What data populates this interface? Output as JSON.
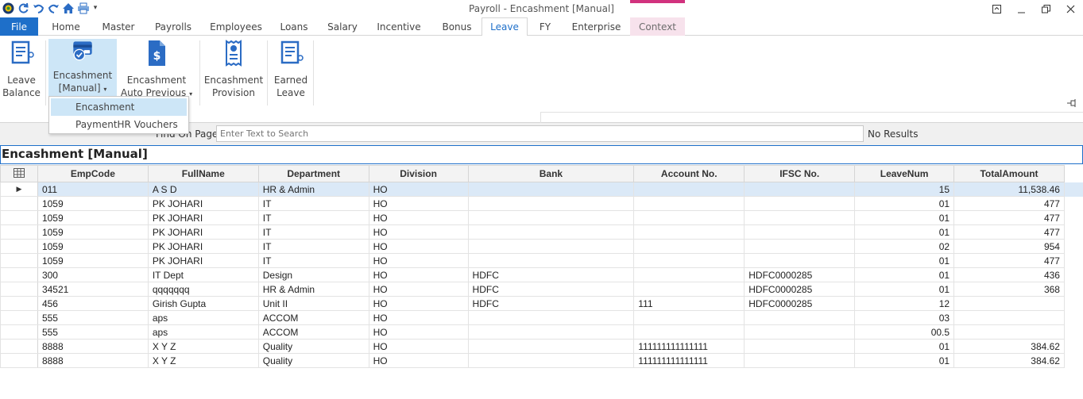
{
  "window": {
    "title": "Payroll - Encashment [Manual]"
  },
  "quick_access": [
    "app-logo-icon",
    "refresh-icon",
    "undo-icon",
    "redo-icon",
    "home-icon",
    "print-icon",
    "dropdown-arrow-icon"
  ],
  "tabs": [
    {
      "label": "File"
    },
    {
      "label": "Home"
    },
    {
      "label": "Master"
    },
    {
      "label": "Payrolls"
    },
    {
      "label": "Employees"
    },
    {
      "label": "Loans"
    },
    {
      "label": "Salary"
    },
    {
      "label": "Incentive"
    },
    {
      "label": "Bonus"
    },
    {
      "label": "Leave"
    },
    {
      "label": "FY"
    },
    {
      "label": "Enterprise"
    },
    {
      "label": "Context"
    }
  ],
  "ribbon": {
    "leave_balance": {
      "line1": "Leave",
      "line2": "Balance"
    },
    "encashment_manual": {
      "line1": "Encashment",
      "line2": "[Manual]"
    },
    "encashment_auto": {
      "line1": "Encashment",
      "line2": "Auto Previous"
    },
    "encashment_provision": {
      "line1": "Encashment",
      "line2": "Provision"
    },
    "earned_leave": {
      "line1": "Earned",
      "line2": "Leave"
    }
  },
  "dropdown": {
    "items": [
      "Encashment",
      "PaymentHR Vouchers"
    ]
  },
  "find": {
    "label": "Find On Page",
    "placeholder": "Enter Text to Search",
    "result": "No Results"
  },
  "grid": {
    "title": "Encashment [Manual]",
    "columns": [
      "EmpCode",
      "FullName",
      "Department",
      "Division",
      "Bank",
      "Account No.",
      "IFSC No.",
      "LeaveNum",
      "TotalAmount"
    ],
    "rows": [
      [
        "011",
        "A S D",
        "HR & Admin",
        "HO",
        "",
        "",
        "",
        "15",
        "11,538.46"
      ],
      [
        "1059",
        "PK JOHARI",
        "IT",
        "HO",
        "",
        "",
        "",
        "01",
        "477"
      ],
      [
        "1059",
        "PK JOHARI",
        "IT",
        "HO",
        "",
        "",
        "",
        "01",
        "477"
      ],
      [
        "1059",
        "PK JOHARI",
        "IT",
        "HO",
        "",
        "",
        "",
        "01",
        "477"
      ],
      [
        "1059",
        "PK JOHARI",
        "IT",
        "HO",
        "",
        "",
        "",
        "02",
        "954"
      ],
      [
        "1059",
        "PK JOHARI",
        "IT",
        "HO",
        "",
        "",
        "",
        "01",
        "477"
      ],
      [
        "300",
        "IT Dept",
        "Design",
        "HO",
        "HDFC",
        "",
        "HDFC0000285",
        "01",
        "436"
      ],
      [
        "34521",
        "qqqqqqq",
        "HR & Admin",
        "HO",
        "HDFC",
        "",
        "HDFC0000285",
        "01",
        "368"
      ],
      [
        "456",
        "Girish Gupta",
        "Unit II",
        "HO",
        "HDFC",
        "111",
        "HDFC0000285",
        "12",
        ""
      ],
      [
        "555",
        "aps",
        "ACCOM",
        "HO",
        "",
        "",
        "",
        "03",
        ""
      ],
      [
        "555",
        "aps",
        "ACCOM",
        "HO",
        "",
        "",
        "",
        "00.5",
        ""
      ],
      [
        "8888",
        "X Y Z",
        "Quality",
        "HO",
        "",
        "111111111111111",
        "",
        "01",
        "384.62"
      ],
      [
        "8888",
        "X Y Z",
        "Quality",
        "HO",
        "",
        "111111111111111",
        "",
        "01",
        "384.62"
      ]
    ]
  },
  "colors": {
    "accent": "#1e6fc9",
    "context_tab": "#d1327e",
    "selection": "#cde6f7"
  }
}
